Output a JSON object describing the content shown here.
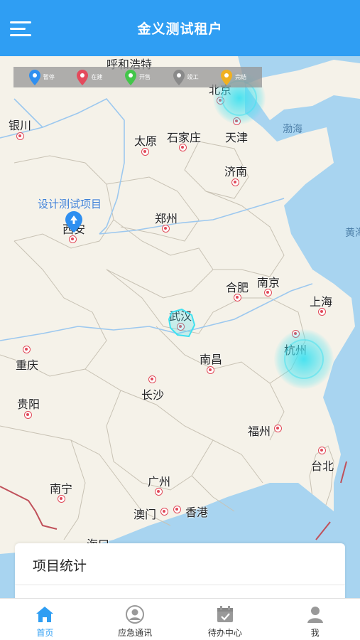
{
  "header": {
    "title": "金义测试租户",
    "menu_icon": "menu-icon"
  },
  "legend": [
    {
      "label": "暂停",
      "color": "#2f8ff0",
      "icon": "pin-icon"
    },
    {
      "label": "在建",
      "color": "#e44a5c",
      "icon": "pin-icon"
    },
    {
      "label": "开售",
      "color": "#43c64a",
      "icon": "pin-icon"
    },
    {
      "label": "竣工",
      "color": "#8a8a8a",
      "icon": "pin-icon"
    },
    {
      "label": "完结",
      "color": "#f0b020",
      "icon": "pin-icon"
    }
  ],
  "map": {
    "cities": {
      "huhehaote": "呼和浩特",
      "beijing": "北京",
      "tianjin": "天津",
      "yinchuan": "银川",
      "taiyuan": "太原",
      "shijiazhuang": "石家庄",
      "jinan": "济南",
      "zhengzhou": "郑州",
      "xian": "西安",
      "hefei": "合肥",
      "nanjing": "南京",
      "shanghai": "上海",
      "wuhan": "武汉",
      "hangzhou": "杭州",
      "chongqing": "重庆",
      "nanchang": "南昌",
      "changsha": "长沙",
      "guiyang": "贵阳",
      "fuzhou": "福州",
      "taibei": "台北",
      "nanning": "南宁",
      "guangzhou": "广州",
      "aomen": "澳门",
      "xianggang": "香港",
      "haikou": "海口"
    },
    "seas": {
      "bohai": "渤海",
      "huanghai": "黄海"
    },
    "project_label": "设计测试项目"
  },
  "stats": {
    "title": "项目统计"
  },
  "nav": [
    {
      "label": "首页",
      "icon": "home-icon",
      "active": true
    },
    {
      "label": "应急通讯",
      "icon": "contact-icon",
      "active": false
    },
    {
      "label": "待办中心",
      "icon": "calendar-check-icon",
      "active": false
    },
    {
      "label": "我",
      "icon": "user-icon",
      "active": false
    }
  ],
  "colors": {
    "brand": "#2f9ef3",
    "pulse": "#40e1f0"
  }
}
